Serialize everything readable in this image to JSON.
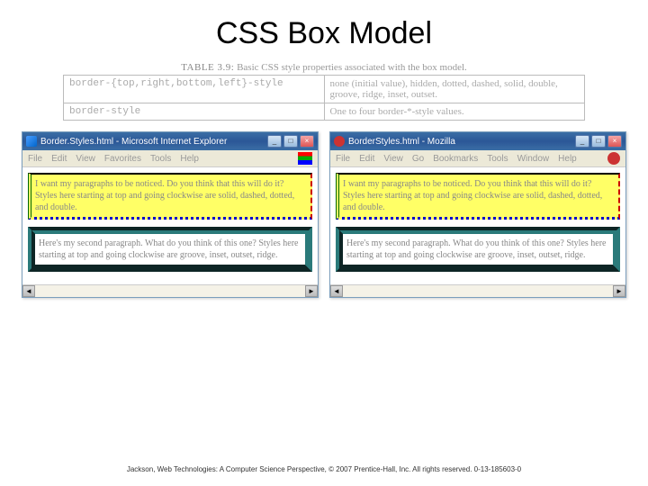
{
  "title": "CSS Box Model",
  "table": {
    "caption_prefix": "TABLE 3.9:",
    "caption": "Basic CSS style properties associated with the box model.",
    "rows": [
      {
        "prop": "border-{top,right,bottom,left}-style",
        "desc": "none (initial value), hidden, dotted, dashed, solid, double, groove, ridge, inset, outset."
      },
      {
        "prop": "border-style",
        "desc": "One to four border-*-style values."
      }
    ]
  },
  "ie": {
    "title": "Border.Styles.html - Microsoft Internet Explorer",
    "menu": [
      "File",
      "Edit",
      "View",
      "Favorites",
      "Tools",
      "Help"
    ],
    "para1": "I want my paragraphs to be noticed. Do you think that this will do it? Styles here starting at top and going clockwise are solid, dashed, dotted, and double.",
    "para2": "Here's my second paragraph. What do you think of this one? Styles here starting at top and going clockwise are groove, inset, outset, ridge."
  },
  "moz": {
    "title": "BorderStyles.html - Mozilla",
    "menu": [
      "File",
      "Edit",
      "View",
      "Go",
      "Bookmarks",
      "Tools",
      "Window",
      "Help"
    ],
    "para1": "I want my paragraphs to be noticed. Do you think that this will do it? Styles here starting at top and going clockwise are solid, dashed, dotted, and double.",
    "para2": "Here's my second paragraph. What do you think of this one? Styles here starting at top and going clockwise are groove, inset, outset, ridge."
  },
  "controls": {
    "min": "_",
    "max": "□",
    "close": "×",
    "left_arrow": "◄",
    "right_arrow": "►"
  },
  "footer": "Jackson, Web Technologies: A Computer Science Perspective, © 2007 Prentice-Hall, Inc. All rights reserved. 0-13-185603-0"
}
